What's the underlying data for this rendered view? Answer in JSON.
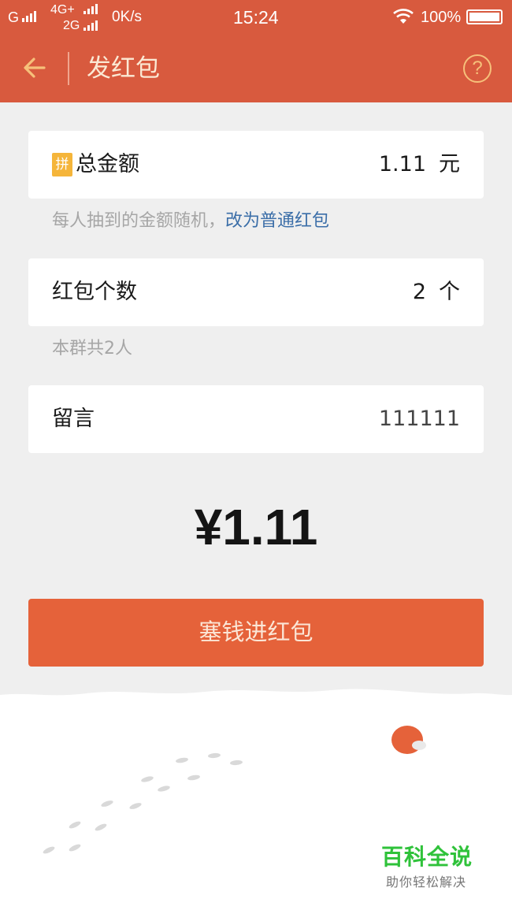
{
  "status_bar": {
    "carrier1": "G",
    "network_top": "4G+",
    "network_bottom": "2G",
    "speed": "0K/s",
    "time": "15:24",
    "battery": "100%"
  },
  "header": {
    "title": "发红包",
    "help": "?"
  },
  "amount_card": {
    "badge": "拼",
    "label": "总金额",
    "value": "1.11",
    "unit": "元"
  },
  "amount_hint": {
    "text": "每人抽到的金额随机，",
    "link": "改为普通红包"
  },
  "count_card": {
    "label": "红包个数",
    "value": "2",
    "unit": "个"
  },
  "count_hint": "本群共2人",
  "message_card": {
    "label": "留言",
    "value": "111111"
  },
  "total": "¥1.11",
  "send_button": "塞钱进红包",
  "watermark": {
    "main": "百科全说",
    "sub": "助你轻松解决"
  },
  "colors": {
    "header": "#d85a3e",
    "button": "#e5623a",
    "link": "#3b6ea8",
    "badge": "#f5b53a"
  }
}
